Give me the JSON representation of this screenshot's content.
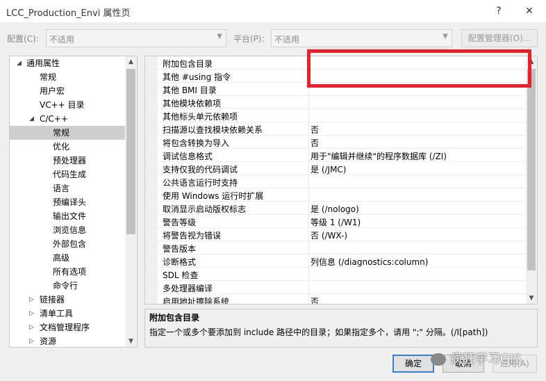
{
  "window": {
    "title": "LCC_Production_Envi 属性页",
    "help": "?",
    "close": "✕"
  },
  "config": {
    "config_label": "配置(C):",
    "config_value": "不适用",
    "platform_label": "平台(P):",
    "platform_value": "不适用",
    "manager_label": "配置管理器(O)..."
  },
  "tree": {
    "items": [
      {
        "label": "通用属性",
        "twisty": "◢"
      },
      {
        "label": "常规"
      },
      {
        "label": "用户宏"
      },
      {
        "label": "VC++ 目录"
      },
      {
        "label": "C/C++",
        "twisty": "◢"
      },
      {
        "label": "常规"
      },
      {
        "label": "优化"
      },
      {
        "label": "预处理器"
      },
      {
        "label": "代码生成"
      },
      {
        "label": "语言"
      },
      {
        "label": "预编译头"
      },
      {
        "label": "输出文件"
      },
      {
        "label": "浏览信息"
      },
      {
        "label": "外部包含"
      },
      {
        "label": "高级"
      },
      {
        "label": "所有选项"
      },
      {
        "label": "命令行"
      },
      {
        "label": "链接器",
        "twisty": "▷"
      },
      {
        "label": "清单工具",
        "twisty": "▷"
      },
      {
        "label": "文档管理程序",
        "twisty": "▷"
      },
      {
        "label": "资源",
        "twisty": "▷"
      }
    ],
    "selected_index": 5
  },
  "properties": [
    {
      "name": "附加包含目录",
      "value": ""
    },
    {
      "name": "其他 #using 指令",
      "value": ""
    },
    {
      "name": "其他 BMI 目录",
      "value": ""
    },
    {
      "name": "其他模块依赖项",
      "value": ""
    },
    {
      "name": "其他标头单元依赖项",
      "value": ""
    },
    {
      "name": "扫描源以查找模块依赖关系",
      "value": "否"
    },
    {
      "name": "将包含转换为导入",
      "value": "否"
    },
    {
      "name": "调试信息格式",
      "value": "用于\"编辑并继续\"的程序数据库 (/ZI)"
    },
    {
      "name": "支持仅我的代码调试",
      "value": "是 (/JMC)"
    },
    {
      "name": "公共语言运行时支持",
      "value": ""
    },
    {
      "name": "使用 Windows 运行时扩展",
      "value": ""
    },
    {
      "name": "取消显示启动版权标志",
      "value": "是 (/nologo)"
    },
    {
      "name": "警告等级",
      "value": "等级 1 (/W1)"
    },
    {
      "name": "将警告视为错误",
      "value": "否 (/WX-)"
    },
    {
      "name": "警告版本",
      "value": ""
    },
    {
      "name": "诊断格式",
      "value": "列信息 (/diagnostics:column)"
    },
    {
      "name": "SDL 检查",
      "value": ""
    },
    {
      "name": "多处理器编译",
      "value": ""
    },
    {
      "name": "启用地址擦除系统",
      "value": "否"
    }
  ],
  "description": {
    "heading": "附加包含目录",
    "text": "指定一个或多个要添加到 include 路径中的目录；如果指定多个，请用 \";\" 分隔。(/I[path])"
  },
  "buttons": {
    "ok": "确定",
    "cancel": "取消",
    "apply": "应用(A)"
  },
  "watermark": "疯狂学习GIS",
  "highlight_color": "#e8202a"
}
